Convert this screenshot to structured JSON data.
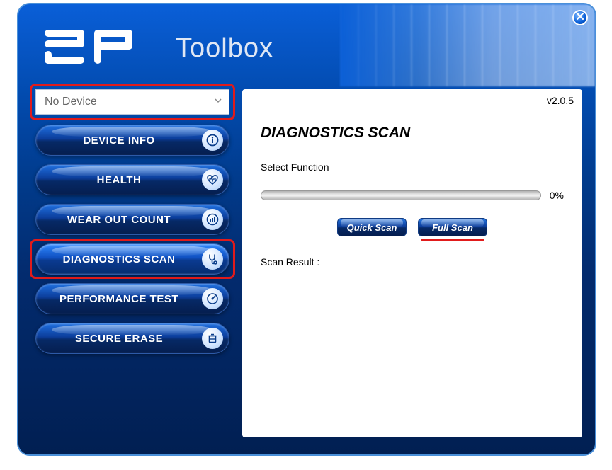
{
  "header": {
    "title": "Toolbox"
  },
  "version": "v2.0.5",
  "deviceSelector": {
    "value": "No Device"
  },
  "sidebar": {
    "items": [
      {
        "label": "DEVICE INFO",
        "icon": "info-icon"
      },
      {
        "label": "HEALTH",
        "icon": "heart-icon"
      },
      {
        "label": "WEAR OUT COUNT",
        "icon": "chart-icon"
      },
      {
        "label": "DIAGNOSTICS SCAN",
        "icon": "stethoscope-icon"
      },
      {
        "label": "PERFORMANCE TEST",
        "icon": "gauge-icon"
      },
      {
        "label": "SECURE ERASE",
        "icon": "trash-icon"
      }
    ]
  },
  "panel": {
    "title": "DIAGNOSTICS SCAN",
    "subtitle": "Select Function",
    "progressPercent": "0%",
    "quickScanLabel": "Quick Scan",
    "fullScanLabel": "Full Scan",
    "resultLabel": "Scan Result :"
  }
}
